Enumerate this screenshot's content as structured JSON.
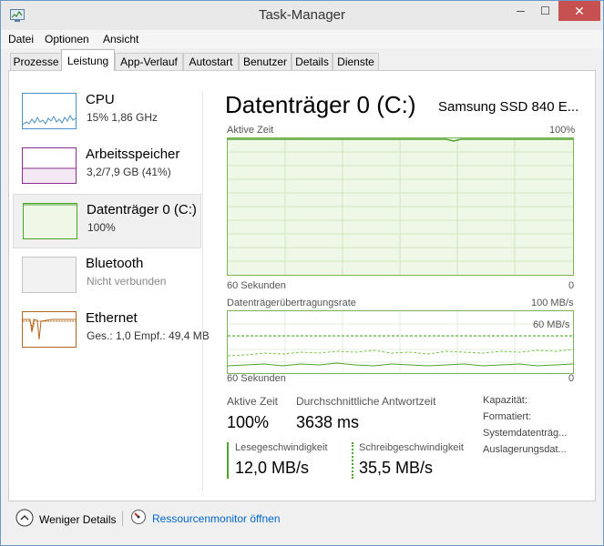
{
  "window": {
    "title": "Task-Manager",
    "controls": {
      "minimize": "─",
      "maximize": "☐",
      "close": "✕"
    }
  },
  "menu": [
    "Datei",
    "Optionen",
    "Ansicht"
  ],
  "tabs": [
    "Prozesse",
    "Leistung",
    "App-Verlauf",
    "Autostart",
    "Benutzer",
    "Details",
    "Dienste"
  ],
  "active_tab": "Leistung",
  "sidebar": {
    "items": [
      {
        "title": "CPU",
        "subtitle": "15% 1,86 GHz",
        "color": "#4a90c8"
      },
      {
        "title": "Arbeitsspeicher",
        "subtitle": "3,2/7,9 GB (41%)",
        "color": "#8b2e8b"
      },
      {
        "title": "Datenträger 0 (C:)",
        "subtitle": "100%",
        "color": "#4da42a",
        "selected": true
      },
      {
        "title": "Bluetooth",
        "subtitle": "Nicht verbunden",
        "color": "#c4c4c4"
      },
      {
        "title": "Ethernet",
        "subtitle_send": "Ges.: 1,0",
        "subtitle_recv": "Empf.: 49,4 MB",
        "subtitle": "Ges.: 1,0  Empf.: 49,4 MB",
        "color": "#b5651d"
      }
    ]
  },
  "main": {
    "title": "Datenträger 0 (C:)",
    "device": "Samsung SSD 840 E...",
    "graph1": {
      "label": "Aktive Zeit",
      "max": "100%",
      "time": "60 Sekunden",
      "min": "0",
      "level_percent": 100
    },
    "graph2": {
      "label": "Datenträgerübertragungsrate",
      "max": "100 MB/s",
      "mid": "60 MB/s",
      "time": "60 Sekunden",
      "min": "0"
    },
    "stats": {
      "active_time_label": "Aktive Zeit",
      "active_time_value": "100%",
      "avg_response_label": "Durchschnittliche Antwortzeit",
      "avg_response_value": "3638 ms",
      "read_label": "Lesegeschwindigkeit",
      "read_value": "12,0 MB/s",
      "write_label": "Schreibgeschwindigkeit",
      "write_value": "35,5 MB/s"
    },
    "properties": [
      "Kapazität:",
      "Formatiert:",
      "Systemdatenträg...",
      "Auslagerungsdat..."
    ]
  },
  "footer": {
    "less_details": "Weniger Details",
    "resource_monitor": "Ressourcenmonitor öffnen"
  },
  "colors": {
    "accent_green": "#4da42a",
    "graph_fill": "#eff7e7",
    "link": "#0066cc",
    "close_red": "#c75050"
  }
}
